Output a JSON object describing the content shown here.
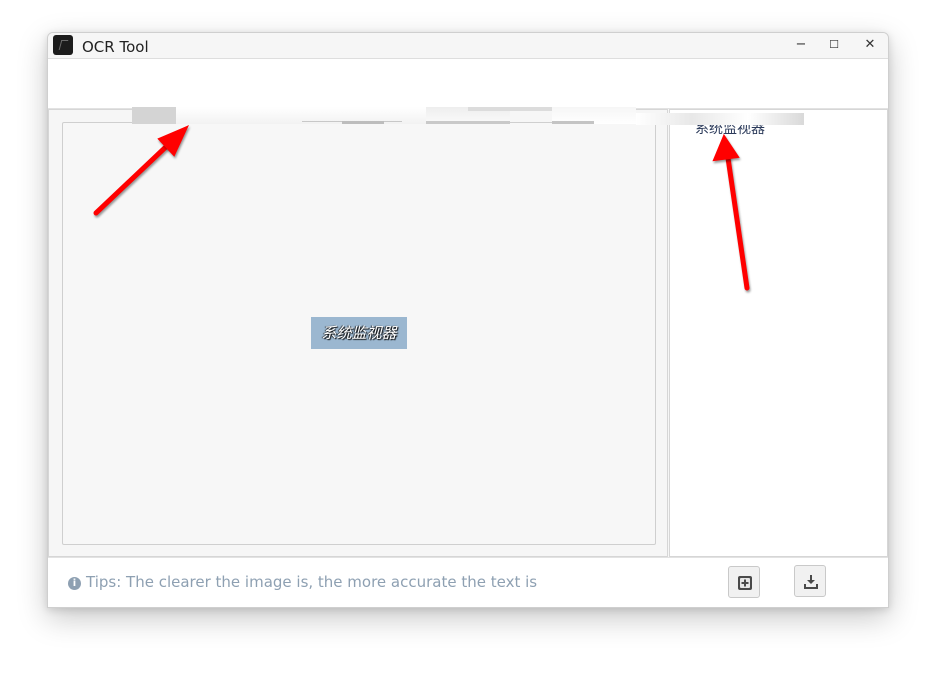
{
  "window": {
    "title": "OCR Tool",
    "controls": {
      "minimize": "−",
      "maximize": "☐",
      "close": "✕"
    }
  },
  "image_view": {
    "snippet_text": "系统监视器"
  },
  "result_panel": {
    "recognized_text": "系统监视器"
  },
  "status_bar": {
    "tips": "Tips: The clearer the image is, the more accurate the text is",
    "info_icon": "info-icon"
  },
  "buttons": [
    {
      "icon": "copy-add-icon"
    },
    {
      "icon": "download-icon"
    }
  ],
  "annotations": {
    "arrow_color": "#ff0000"
  }
}
